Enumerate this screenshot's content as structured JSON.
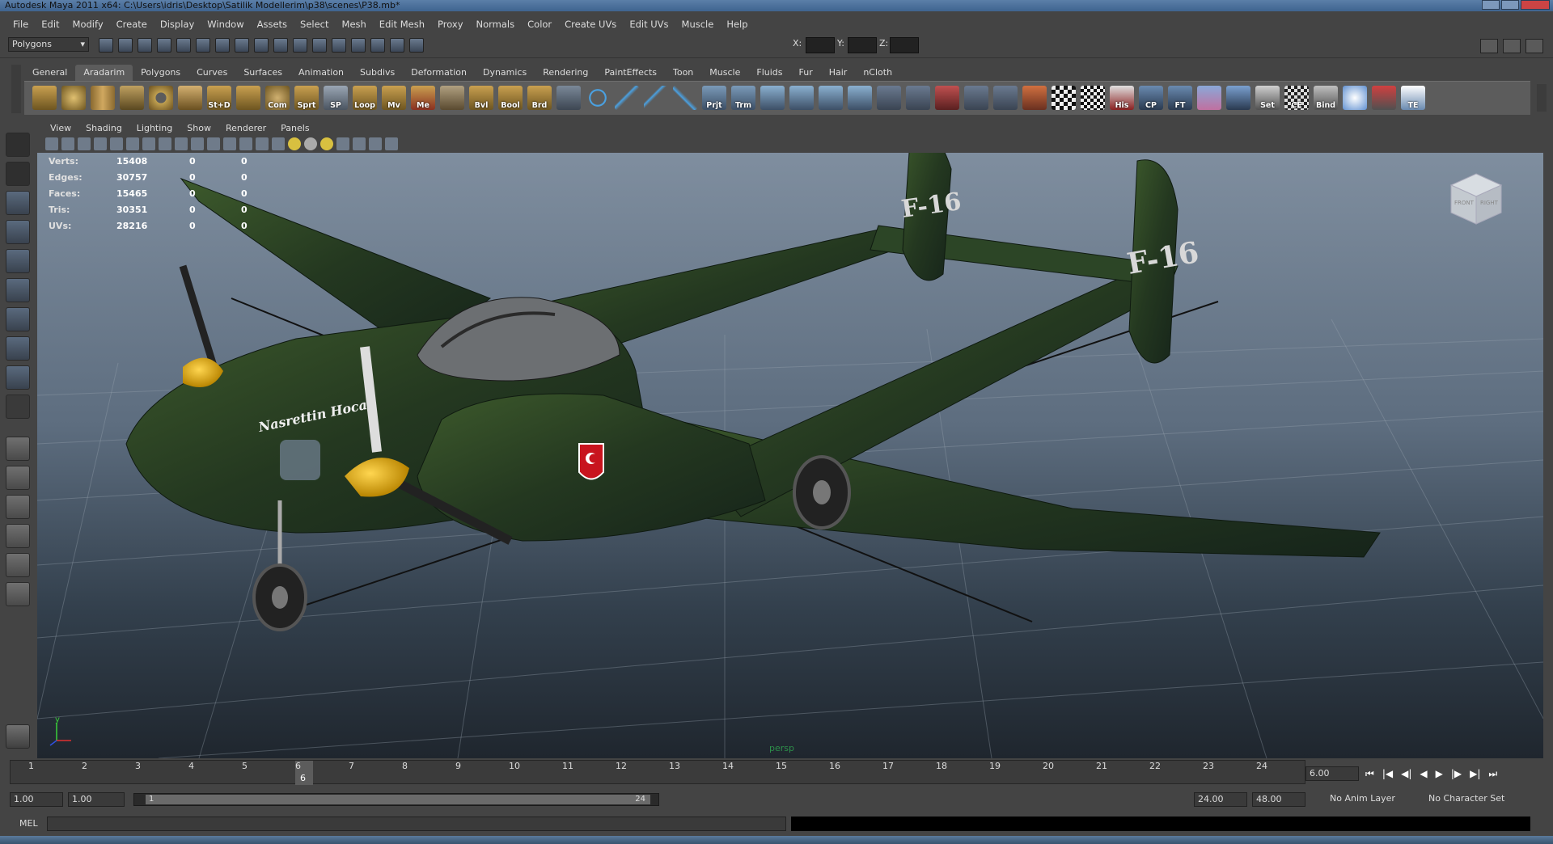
{
  "window": {
    "title": "Autodesk Maya 2011 x64: C:\\Users\\idris\\Desktop\\Satilik Modellerim\\p38\\scenes\\P38.mb*"
  },
  "menu": [
    "File",
    "Edit",
    "Modify",
    "Create",
    "Display",
    "Window",
    "Assets",
    "Select",
    "Mesh",
    "Edit Mesh",
    "Proxy",
    "Normals",
    "Color",
    "Create UVs",
    "Edit UVs",
    "Muscle",
    "Help"
  ],
  "status_line": {
    "mode": "Polygons",
    "x_label": "X:",
    "y_label": "Y:",
    "z_label": "Z:"
  },
  "shelf": {
    "tabs": [
      "General",
      "Aradarim",
      "Polygons",
      "Curves",
      "Surfaces",
      "Animation",
      "Subdivs",
      "Deformation",
      "Dynamics",
      "Rendering",
      "PaintEffects",
      "Toon",
      "Muscle",
      "Fluids",
      "Fur",
      "Hair",
      "nCloth"
    ],
    "active_tab": "Aradarim",
    "labels": [
      "St+D",
      "Com",
      "Sprt",
      "SP",
      "Loop",
      "Mv",
      "Me",
      "Bvl",
      "Bool",
      "Brd",
      "Prjt",
      "Trm",
      "His",
      "CP",
      "FT",
      "Set",
      "CE",
      "Bind",
      "TE"
    ]
  },
  "panel": {
    "menu": [
      "View",
      "Shading",
      "Lighting",
      "Show",
      "Renderer",
      "Panels"
    ],
    "camera": "persp"
  },
  "hud": {
    "rows": [
      {
        "label": "Verts:",
        "a": "15408",
        "b": "0",
        "c": "0"
      },
      {
        "label": "Edges:",
        "a": "30757",
        "b": "0",
        "c": "0"
      },
      {
        "label": "Faces:",
        "a": "15465",
        "b": "0",
        "c": "0"
      },
      {
        "label": "Tris:",
        "a": "30351",
        "b": "0",
        "c": "0"
      },
      {
        "label": "UVs:",
        "a": "28216",
        "b": "0",
        "c": "0"
      }
    ]
  },
  "aircraft": {
    "nose_text": "Nasrettin Hoca",
    "tail_text": "F-16"
  },
  "view_cube": {
    "front": "FRONT",
    "right": "RIGHT"
  },
  "axis": {
    "y": "y"
  },
  "timeline": {
    "ticks": [
      "1",
      "2",
      "3",
      "4",
      "5",
      "6",
      "7",
      "8",
      "9",
      "10",
      "11",
      "12",
      "13",
      "14",
      "15",
      "16",
      "17",
      "18",
      "19",
      "20",
      "21",
      "22",
      "23",
      "24"
    ],
    "current_frame": "6",
    "current_field": "6.00",
    "controls": [
      "⏮",
      "|◀",
      "◀|",
      "◀",
      "▶",
      "|▶",
      "▶|",
      "⏭"
    ]
  },
  "range": {
    "start_time": "1.00",
    "start_range": "1.00",
    "range_start_label": "1",
    "range_end_label": "24",
    "end_range": "24.00",
    "end_time": "48.00",
    "anim_layer": "No Anim Layer",
    "char_set": "No Character Set"
  },
  "command": {
    "lang": "MEL"
  },
  "colors": {
    "bg": "#444444",
    "viewport_top": "#7f8e9f",
    "viewport_bottom": "#1f262e",
    "plane": "#2f4a2a",
    "spinner": "#e8b21a"
  }
}
